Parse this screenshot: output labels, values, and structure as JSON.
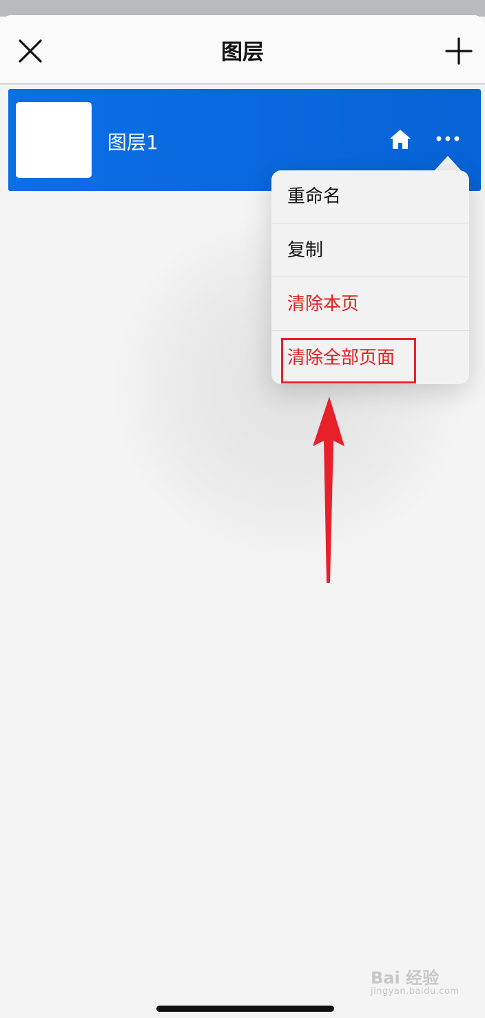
{
  "header": {
    "title": "图层",
    "close_icon": "close-icon",
    "add_icon": "plus-icon"
  },
  "layers": [
    {
      "name": "图层1",
      "selected": true,
      "home_icon": "home-icon",
      "more_icon": "more-dots-icon"
    }
  ],
  "context_menu": {
    "items": [
      {
        "label": "重命名",
        "danger": false
      },
      {
        "label": "复制",
        "danger": false
      },
      {
        "label": "清除本页",
        "danger": true
      },
      {
        "label": "清除全部页面",
        "danger": true,
        "highlighted": true
      }
    ]
  },
  "annotation": {
    "arrow_color": "#e8202a",
    "box_color": "#e8202a"
  },
  "watermark": {
    "brand": "Bai 经验",
    "url": "jingyan.baidu.com"
  },
  "colors": {
    "accent": "#0b6fe6",
    "danger": "#e02020",
    "background": "#f4f4f4"
  }
}
